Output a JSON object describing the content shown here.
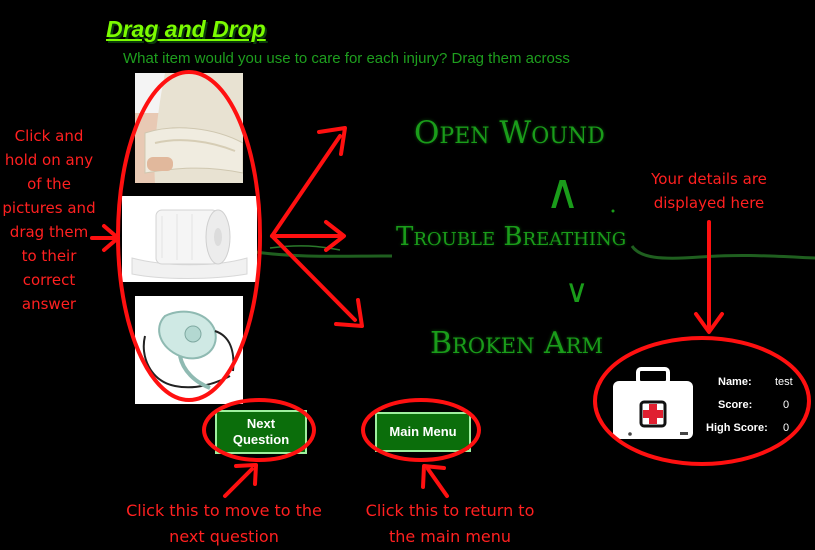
{
  "header": {
    "title": "Drag and Drop",
    "instruction": "What item would you use to care for each injury? Drag them across"
  },
  "draggables": [
    {
      "name": "arm-sling"
    },
    {
      "name": "bandage-roll"
    },
    {
      "name": "oxygen-mask"
    }
  ],
  "options": [
    "Open Wound",
    "Trouble Breathing",
    "Broken Arm"
  ],
  "buttons": {
    "next_label": "Next Question",
    "menu_label": "Main Menu"
  },
  "player": {
    "name_label": "Name:",
    "name_value": "test",
    "score_label": "Score:",
    "score_value": "0",
    "high_score_label": "High Score:",
    "high_score_value": "0"
  },
  "callouts": {
    "drag_help": "Click and hold on any of the pictures and drag them to their correct answer",
    "next_help": "Click this to move to the next question",
    "menu_help": "Click this to return to the main menu",
    "details_help": "Your details are displayed here"
  },
  "colors": {
    "background": "#000000",
    "title": "#7cfc00",
    "option_text": "#1a9c1a",
    "button_bg": "#0b6e0b",
    "annotation": "#ff2020"
  },
  "icons": [
    "first-aid-kit-icon"
  ]
}
